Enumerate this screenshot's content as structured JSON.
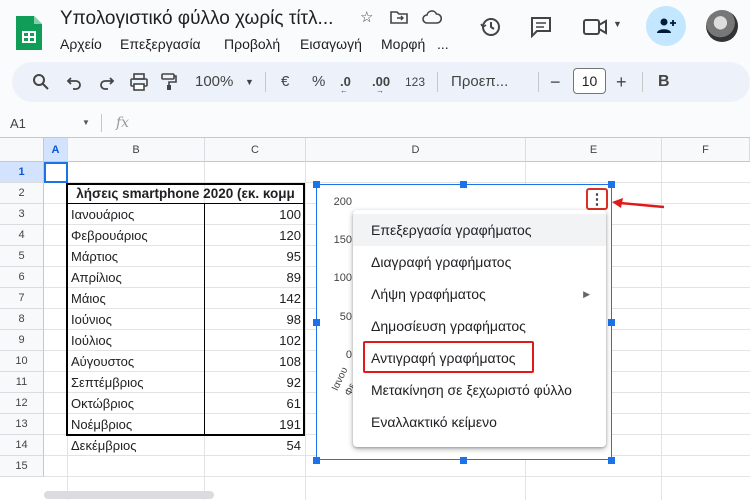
{
  "app": {
    "title": "Υπολογιστικό φύλλο χωρίς τίτλ...",
    "menu": [
      "Αρχείο",
      "Επεξεργασία",
      "Προβολή",
      "Εισαγωγή",
      "Μορφή",
      "..."
    ]
  },
  "toolbar": {
    "zoom": "100%",
    "currency": "€",
    "percent": "%",
    "dec_decrease": ".0",
    "dec_increase": ".00",
    "format_123": "123",
    "font": "Προεπ...",
    "font_size": "10",
    "minus": "−",
    "plus": "+"
  },
  "formula_bar": {
    "name_box": "A1",
    "fx": "fx"
  },
  "sheet": {
    "columns": [
      "A",
      "B",
      "C",
      "D",
      "E",
      "F"
    ],
    "rows": [
      "1",
      "2",
      "3",
      "4",
      "5",
      "6",
      "7",
      "8",
      "9",
      "10",
      "11",
      "12",
      "13",
      "14",
      "15"
    ],
    "title_cell": "λήσεις smartphone 2020 (εκ. κομμ",
    "data": [
      {
        "month": "Ιανουάριος",
        "value": "100"
      },
      {
        "month": "Φεβρουάριος",
        "value": "120"
      },
      {
        "month": "Μάρτιος",
        "value": "95"
      },
      {
        "month": "Απρίλιος",
        "value": "89"
      },
      {
        "month": "Μάιος",
        "value": "142"
      },
      {
        "month": "Ιούνιος",
        "value": "98"
      },
      {
        "month": "Ιούλιος",
        "value": "102"
      },
      {
        "month": "Αύγουστος",
        "value": "108"
      },
      {
        "month": "Σεπτέμβριος",
        "value": "92"
      },
      {
        "month": "Οκτώβριος",
        "value": "61"
      },
      {
        "month": "Νοέμβριος",
        "value": "191"
      },
      {
        "month": "Δεκέμβριος",
        "value": "54"
      }
    ]
  },
  "chart": {
    "y_ticks": [
      "200",
      "150",
      "100",
      "50",
      "0"
    ],
    "x_label_partial": [
      "Ιανου",
      "Φε"
    ],
    "kebab": "⋮"
  },
  "context_menu": {
    "items": [
      {
        "label": "Επεξεργασία γραφήματος"
      },
      {
        "label": "Διαγραφή γραφήματος"
      },
      {
        "label": "Λήψη γραφήματος",
        "arrow": "▶"
      },
      {
        "label": "Δημοσίευση γραφήματος"
      },
      {
        "label": "Αντιγραφή γραφήματος"
      },
      {
        "label": "Μετακίνηση σε ξεχωριστό φύλλο"
      },
      {
        "label": "Εναλλακτικό κείμενο"
      }
    ]
  },
  "colors": {
    "accent": "#1a73e8",
    "highlight": "#e01a1a",
    "share_bg": "#c2e7ff"
  }
}
